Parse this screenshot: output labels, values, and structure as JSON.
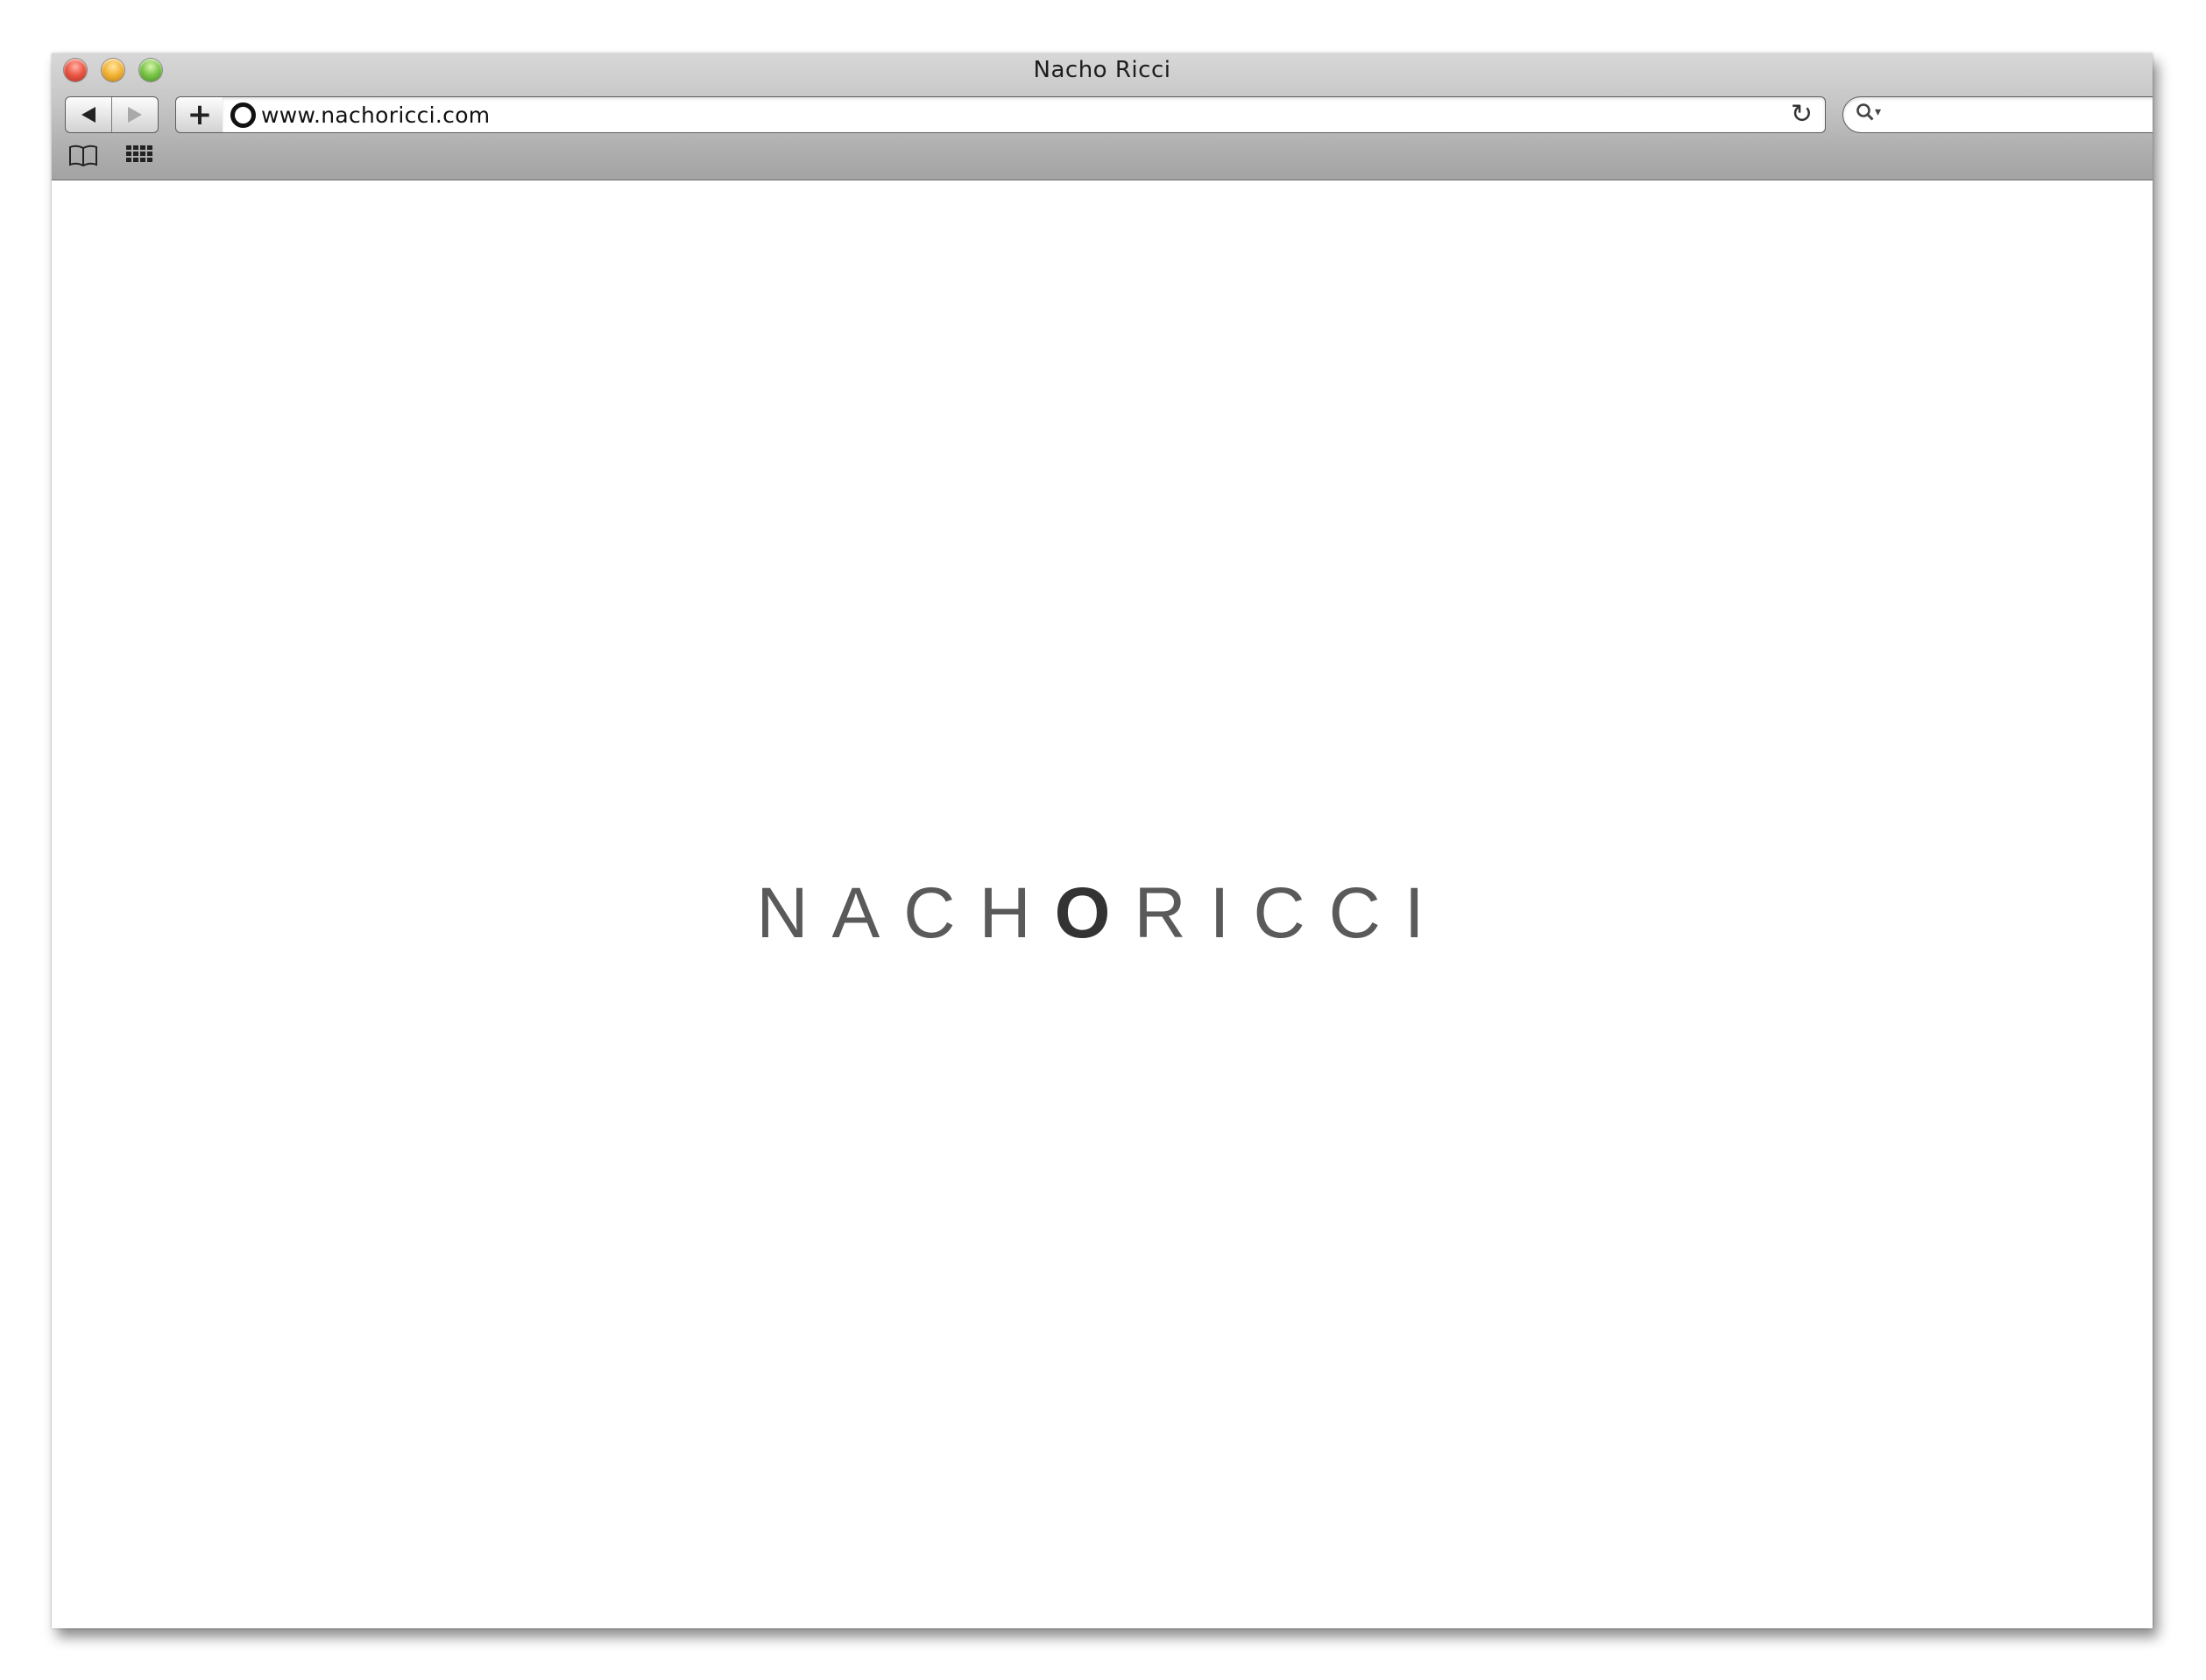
{
  "window": {
    "title": "Nacho Ricci"
  },
  "toolbar": {
    "add_label": "+",
    "url": "www.nachoricci.com",
    "reload_glyph": "↻",
    "search_placeholder": "",
    "search_glyph": "🔍︎"
  },
  "icons": [
    "back-icon",
    "forward-icon",
    "add-bookmark-icon",
    "site-favicon",
    "reload-icon",
    "search-icon",
    "bookmarks-book-icon",
    "top-sites-grid-icon"
  ],
  "page": {
    "logo_part1": "NACH",
    "logo_highlight": "O",
    "logo_part2": "RICCI"
  },
  "colors": {
    "logo_text": "#5a5a5a",
    "logo_highlight": "#333333",
    "chrome_bottom": "#a3a3a3"
  }
}
